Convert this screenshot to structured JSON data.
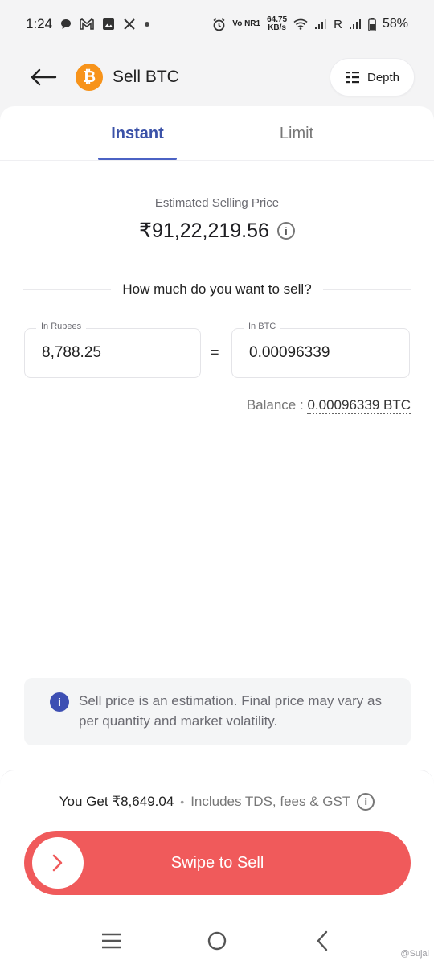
{
  "status_bar": {
    "time": "1:24",
    "net_speed_value": "64.75",
    "net_speed_unit": "KB/s",
    "volte_label": "Vo NR1",
    "roaming_label": "R",
    "battery": "58%"
  },
  "header": {
    "title": "Sell BTC",
    "coin_symbol": "₿",
    "depth_label": "Depth"
  },
  "tabs": [
    {
      "label": "Instant",
      "active": true
    },
    {
      "label": "Limit",
      "active": false
    }
  ],
  "price": {
    "label": "Estimated Selling Price",
    "value": "₹91,22,219.56"
  },
  "question": "How much do you want to sell?",
  "inputs": {
    "rupees_label": "In Rupees",
    "rupees_value": "8,788.25",
    "equals": "=",
    "btc_label": "In BTC",
    "btc_value": "0.00096339"
  },
  "balance": {
    "label": "Balance :",
    "value": "0.00096339 BTC"
  },
  "notice": {
    "text": "Sell price is an estimation. Final price may vary as per quantity and market volatility."
  },
  "summary": {
    "you_get": "You Get ₹8,649.04",
    "separator": "•",
    "includes": "Includes TDS, fees & GST"
  },
  "swipe": {
    "label": "Swipe to Sell"
  },
  "watermark": "@Sujal",
  "colors": {
    "accent": "#3b52a8",
    "swipe": "#f05a5b",
    "bitcoin": "#f7931a",
    "info": "#3d4fb3"
  }
}
